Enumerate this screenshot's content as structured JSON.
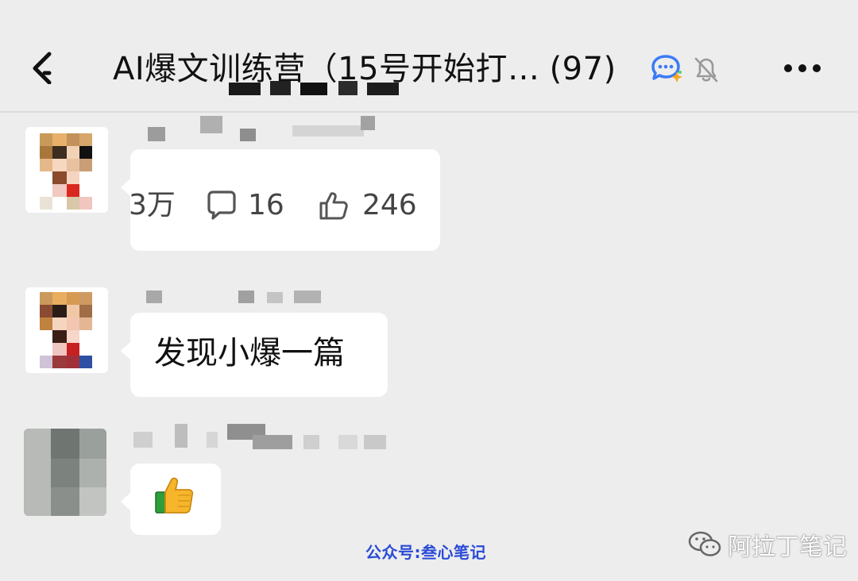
{
  "header": {
    "title": "AI爆文训练营（15号开始打…",
    "member_count": "(97)",
    "back_icon": "back-arrow-icon",
    "ai_chat_icon": "chat-bubble-sparkle-icon",
    "mute_icon": "bell-off-icon",
    "more_icon": "more-dots-icon"
  },
  "messages": [
    {
      "sender": "redacted",
      "type": "article-stats",
      "views_partial": "3万",
      "comments": "16",
      "likes": "246"
    },
    {
      "sender": "redacted",
      "type": "text",
      "text": "发现小爆一篇"
    },
    {
      "sender": "redacted",
      "type": "emoji",
      "emoji": "👍"
    }
  ],
  "watermarks": {
    "left": "公众号:叁心笔记",
    "right": "阿拉丁笔记"
  },
  "colors": {
    "background": "#ededed",
    "bubble": "#ffffff",
    "watermark_blue": "#2a4bd7"
  }
}
